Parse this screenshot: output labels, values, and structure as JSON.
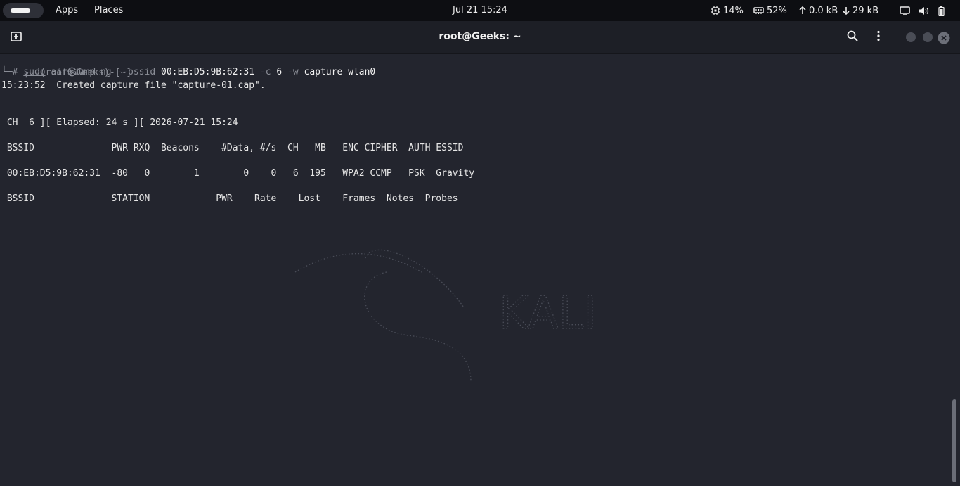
{
  "topbar": {
    "apps": "Apps",
    "places": "Places",
    "clock": "Jul 21  15:24",
    "cpu": "14%",
    "memory": "52%",
    "net_up": "0.0 kB",
    "net_down": "29 kB"
  },
  "window": {
    "title": "root@Geeks: ~"
  },
  "terminal": {
    "prompt_top": "┌──(root㉿Geeks)-[~]",
    "prompt_hash": "└─#",
    "cmd_sudo": "sudo",
    "cmd_prog": "airodump-ng",
    "cmd_opt1": "--bssid",
    "cmd_val1": "00:EB:D5:9B:62:31",
    "cmd_opt2": "-c",
    "cmd_val2": "6",
    "cmd_opt3": "-w",
    "cmd_rest": "capture wlan0",
    "created_line": "15:23:52  Created capture file \"capture-01.cap\".",
    "status_line": " CH  6 ][ Elapsed: 24 s ][ 2026-07-21 15:24",
    "ap_header": " BSSID              PWR RXQ  Beacons    #Data, #/s  CH   MB   ENC CIPHER  AUTH ESSID",
    "ap_row": " 00:EB:D5:9B:62:31  -80   0        1        0    0   6  195   WPA2 CCMP   PSK  Gravity",
    "station_header": " BSSID              STATION            PWR    Rate    Lost    Frames  Notes  Probes"
  },
  "watermark": "KALI"
}
